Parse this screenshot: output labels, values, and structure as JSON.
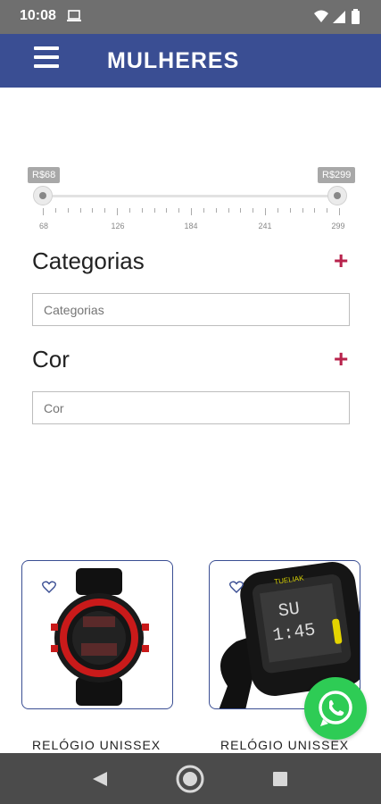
{
  "status_bar": {
    "time": "10:08"
  },
  "app_bar": {
    "title": "MULHERES"
  },
  "price_filter": {
    "min_label": "R$68",
    "max_label": "R$299",
    "min_value": 68,
    "max_value": 299,
    "tick_labels": [
      "68",
      "126",
      "184",
      "241",
      "299"
    ]
  },
  "filters": {
    "categories": {
      "title": "Categorias",
      "plus": "+",
      "placeholder": "Categorias"
    },
    "color": {
      "title": "Cor",
      "plus": "+",
      "placeholder": "Cor"
    }
  },
  "products": [
    {
      "name": "RELÓGIO UNISSEX",
      "image": "red-black-sport-watch"
    },
    {
      "name": "RELÓGIO UNISSEX",
      "image": "black-digital-watch",
      "screen_text": "TUELIAK"
    }
  ],
  "colors": {
    "accent": "#3a4e93",
    "plus": "#b8234c",
    "whatsapp": "#2ecc55"
  }
}
